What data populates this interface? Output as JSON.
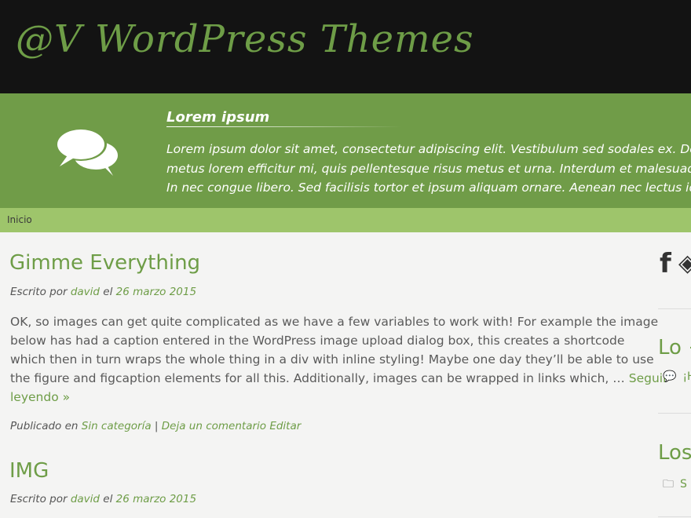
{
  "header": {
    "site_title": "@V WordPress Themes"
  },
  "banner": {
    "title": "Lorem ipsum",
    "lines": [
      "Lorem ipsum dolor sit amet, consectetur adipiscing elit. Vestibulum sed sodales ex. Donec",
      "metus lorem efficitur mi, quis pellentesque risus metus et urna. Interdum et malesuada fa",
      "In nec congue libero. Sed facilisis tortor et ipsum aliquam ornare. Aenean nec lectus id ipsu"
    ]
  },
  "nav": {
    "items": [
      "Inicio"
    ]
  },
  "posts": [
    {
      "title": "Gimme Everything",
      "meta_prefix": "Escrito por",
      "author": "david",
      "meta_mid": "el",
      "date": "26 marzo 2015",
      "excerpt_lines": [
        "OK, so images can get quite complicated as we have a few variables to work with! For example the image",
        "below has had a caption entered in the WordPress image upload dialog box, this creates a shortcode",
        "which then in turn wraps the whole thing in a div with inline styling! Maybe one day they’ll be able to use",
        "the figure and figcaption elements for all this. Additionally, images can be wrapped in links which, …"
      ],
      "read_more_1": "Seguir",
      "read_more_2": "leyendo",
      "read_more_arrow": "»",
      "published_prefix": "Publicado en",
      "category": "Sin categoría",
      "separator": "|",
      "comment_link": "Deja un comentario",
      "edit_link": "Editar"
    },
    {
      "title": "IMG",
      "meta_prefix": "Escrito por",
      "author": "david",
      "meta_mid": "el",
      "date": "26 marzo 2015"
    }
  ],
  "sidebar": {
    "social_icons": [
      "facebook-icon",
      "tag-icon"
    ],
    "social_glyphs": [
      "f",
      "◈"
    ],
    "widget1_title": "Lo +",
    "widget1_item": "¡H",
    "widget1_glyph": "💬",
    "widget2_title": "Los",
    "widget2_item": "S",
    "widget2_glyph": "🗀"
  },
  "colors": {
    "header_bg": "#131313",
    "accent_green": "#6e9d47",
    "banner_green": "#709c48",
    "nav_green": "#9ec56b",
    "page_bg": "#f4f4f3"
  }
}
